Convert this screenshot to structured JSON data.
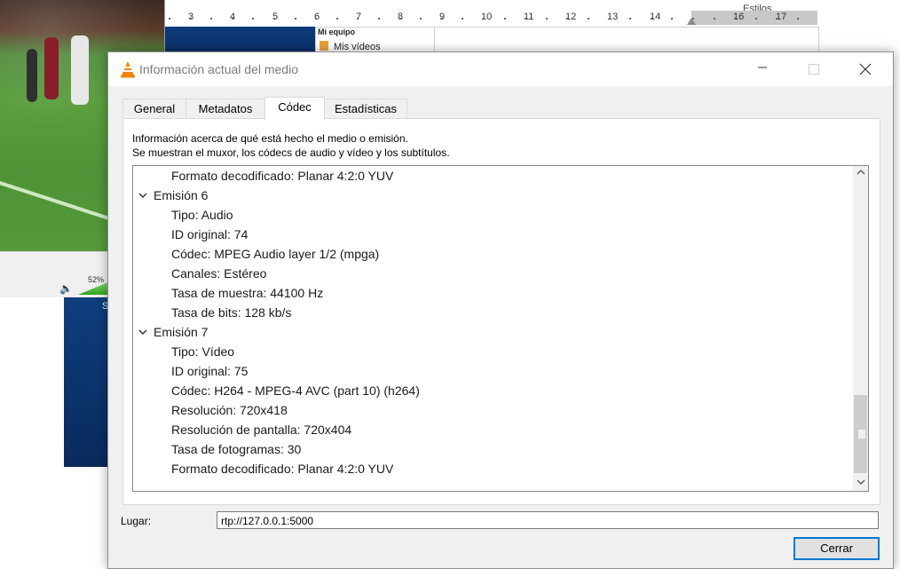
{
  "background": {
    "ruler_title": "Estilos",
    "ruler_numbers": [
      "3",
      "4",
      "5",
      "6",
      "7",
      "8",
      "9",
      "10",
      "11",
      "12",
      "13",
      "14",
      "16",
      "17"
    ],
    "explorer_header": "Mi equipo",
    "explorer_item": "Mis vídeos",
    "desktop_letter": "S",
    "volume_percent": "52%"
  },
  "dialog": {
    "title": "Información actual del medio",
    "window_controls": {
      "minimize": "—",
      "maximize": "□",
      "close": "✕"
    },
    "tabs": [
      {
        "label": "General"
      },
      {
        "label": "Metadatos"
      },
      {
        "label": "Códec"
      },
      {
        "label": "Estadísticas"
      }
    ],
    "active_tab": "Códec",
    "description": {
      "line1": "Información acerca de qué está hecho el medio o emisión.",
      "line2": "Se muestran el muxor, los códecs de audio y vídeo y los subtítulos."
    },
    "tree": [
      {
        "text": "Formato decodificado: Planar 4:2:0 YUV",
        "level": 2
      },
      {
        "text": "Emisión 6",
        "level": 1,
        "expanded": true
      },
      {
        "text": "Tipo: Audio",
        "level": 2
      },
      {
        "text": "ID original: 74",
        "level": 2
      },
      {
        "text": "Códec: MPEG Audio layer 1/2 (mpga)",
        "level": 2
      },
      {
        "text": "Canales: Estéreo",
        "level": 2
      },
      {
        "text": "Tasa de muestra: 44100 Hz",
        "level": 2
      },
      {
        "text": "Tasa de bits: 128 kb/s",
        "level": 2
      },
      {
        "text": "Emisión 7",
        "level": 1,
        "expanded": true
      },
      {
        "text": "Tipo: Vídeo",
        "level": 2
      },
      {
        "text": "ID original: 75",
        "level": 2
      },
      {
        "text": "Códec: H264 - MPEG-4 AVC (part 10) (h264)",
        "level": 2
      },
      {
        "text": "Resolución: 720x418",
        "level": 2
      },
      {
        "text": "Resolución de pantalla: 720x404",
        "level": 2
      },
      {
        "text": "Tasa de fotogramas: 30",
        "level": 2
      },
      {
        "text": "Formato decodificado: Planar 4:2:0 YUV",
        "level": 2
      }
    ],
    "location_label": "Lugar:",
    "location_value": "rtp://127.0.0.1:5000",
    "close_button": "Cerrar"
  },
  "colors": {
    "accent": "#0078d7",
    "vlc_orange": "#f08300"
  }
}
